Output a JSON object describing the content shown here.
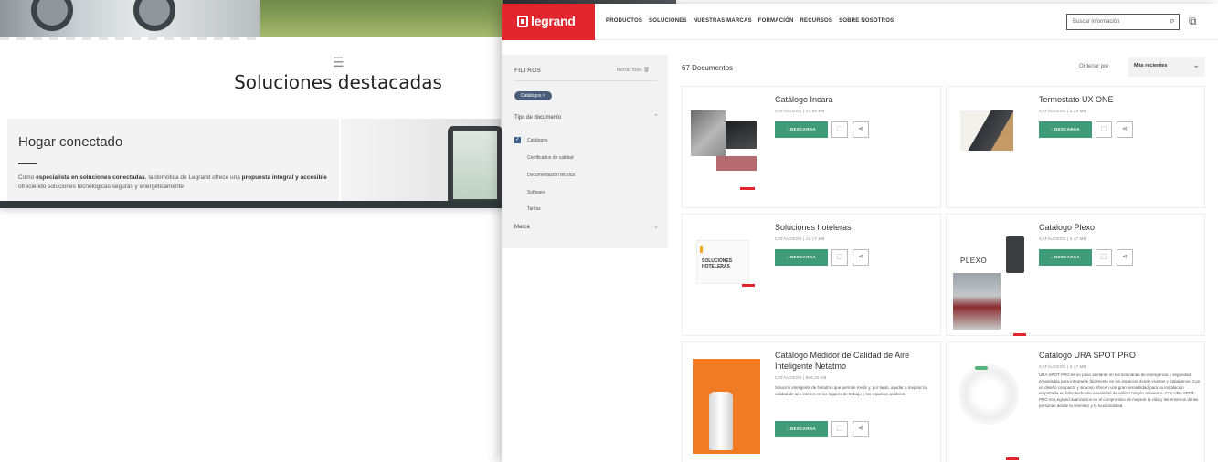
{
  "background_page": {
    "section_title": "Soluciones destacadas",
    "card": {
      "title": "Hogar conectado",
      "text_1": "Como ",
      "text_bold_1": "especialista en soluciones conectadas",
      "text_2": ", la domótica de Legrand ofrece una ",
      "text_bold_2": "propuesta integral y accesible",
      "text_3": " ofreciendo soluciones tecnológicas seguras y energéticamente"
    }
  },
  "window": {
    "logo_text": "legrand",
    "nav": [
      "PRODUCTOS",
      "SOLUCIONES",
      "NUESTRAS MARCAS",
      "FORMACIÓN",
      "RECURSOS",
      "SOBRE NOSOTROS"
    ],
    "search": {
      "placeholder": "Buscar información",
      "icon": "search-icon"
    },
    "sidebar": {
      "title": "FILTROS",
      "clear": "Borrar todo",
      "active_chip": "Catálogos ×",
      "group_type": "Tipo de documento",
      "options": [
        "Catálogos",
        "Certificados de calidad",
        "Documentación técnica",
        "Software",
        "Tarifas"
      ],
      "checked_option": "Catálogos",
      "group_brand": "Marca"
    },
    "doc_count": "67 Documentos",
    "order": {
      "label": "Ordenar por",
      "value": "Más recientes"
    },
    "documents": [
      {
        "title": "Catálogo Incara",
        "meta": "CATÁLOGOS  |  14,68 MB",
        "button": "↓  DESCARGA",
        "description": ""
      },
      {
        "title": "Termostato UX ONE",
        "meta": "CATÁLOGOS  |  3,34 MB",
        "button": "↓  DESCARGA",
        "description": ""
      },
      {
        "title": "Soluciones hoteleras",
        "meta": "CATÁLOGOS  |  13,17 MB",
        "button": "↓  DESCARGA",
        "description": ""
      },
      {
        "title": "Catálogo Plexo",
        "meta": "CATÁLOGOS  |  2,47 MB",
        "button": "↓  DESCARGA",
        "description": ""
      },
      {
        "title": "Catálogo Medidor de Calidad de Aire Inteligente Netatmo",
        "meta": "CATÁLOGOS  |  969,33 KB",
        "button": "↓  DESCARGA",
        "description": "Solución inteligente de Netatmo que permite medir y, por tanto, ayudar a mejorar la calidad de aire interior en los lugares de trabajo y los espacios públicos."
      },
      {
        "title": "Catálogo URA SPOT PRO",
        "meta": "CATÁLOGOS  |  2,47 MB",
        "button": "",
        "description": "URA SPOT PRO es un paso adelante en las luminarias de emergencia y seguridad preparadas para integrarse fácilmente en los espacios donde vivimos y trabajamos. Con un diseño compacto y sinuoso ofrecen una gran versatilidad para su instalación empotrada en falso techo sin necesidad de utilizar ningún accesorio. Con URA SPOT PRO en Legrand avanzamos en el compromiso de mejorar la vida y las entornos de las personas desde la sencillez y la funcionalidad."
      }
    ],
    "thumb_texts": {
      "hotel": "SOLUCIONES HOTELERAS",
      "plexo": "PLEXO"
    }
  },
  "colors": {
    "brand_red": "#e1262d",
    "download_green": "#3f9b7a",
    "chip_blue": "#4a5d7a"
  }
}
